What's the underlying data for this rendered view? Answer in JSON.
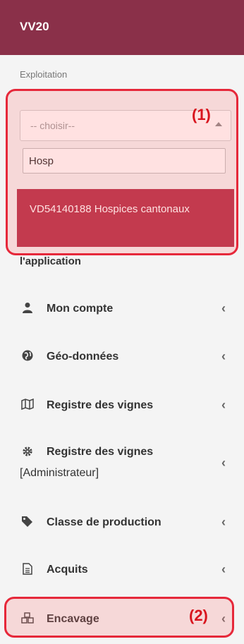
{
  "header": {
    "title": "VV20"
  },
  "exploitation": {
    "section_label": "Exploitation",
    "select_placeholder": "-- choisir--",
    "search_value": "Hosp",
    "selected_option": "VD54140188 Hospices cantonaux"
  },
  "annotations": {
    "one": "(1)",
    "two": "(2)"
  },
  "under_text": "l'application",
  "menu": [
    {
      "label": "Mon compte",
      "icon": "user-icon"
    },
    {
      "label": "Géo-données",
      "icon": "globe-icon"
    },
    {
      "label": "Registre des vignes",
      "icon": "map-icon"
    },
    {
      "label": "Registre des vignes",
      "label2": "[Administrateur]",
      "icon": "gear-icon"
    },
    {
      "label": "Classe de production",
      "icon": "tags-icon"
    },
    {
      "label": "Acquits",
      "icon": "document-icon"
    },
    {
      "label": "Encavage",
      "icon": "cubes-icon"
    }
  ],
  "chevron": "‹",
  "colors": {
    "brand": "#8a3049",
    "highlight": "#b22a43",
    "annotation": "#e6283a"
  }
}
